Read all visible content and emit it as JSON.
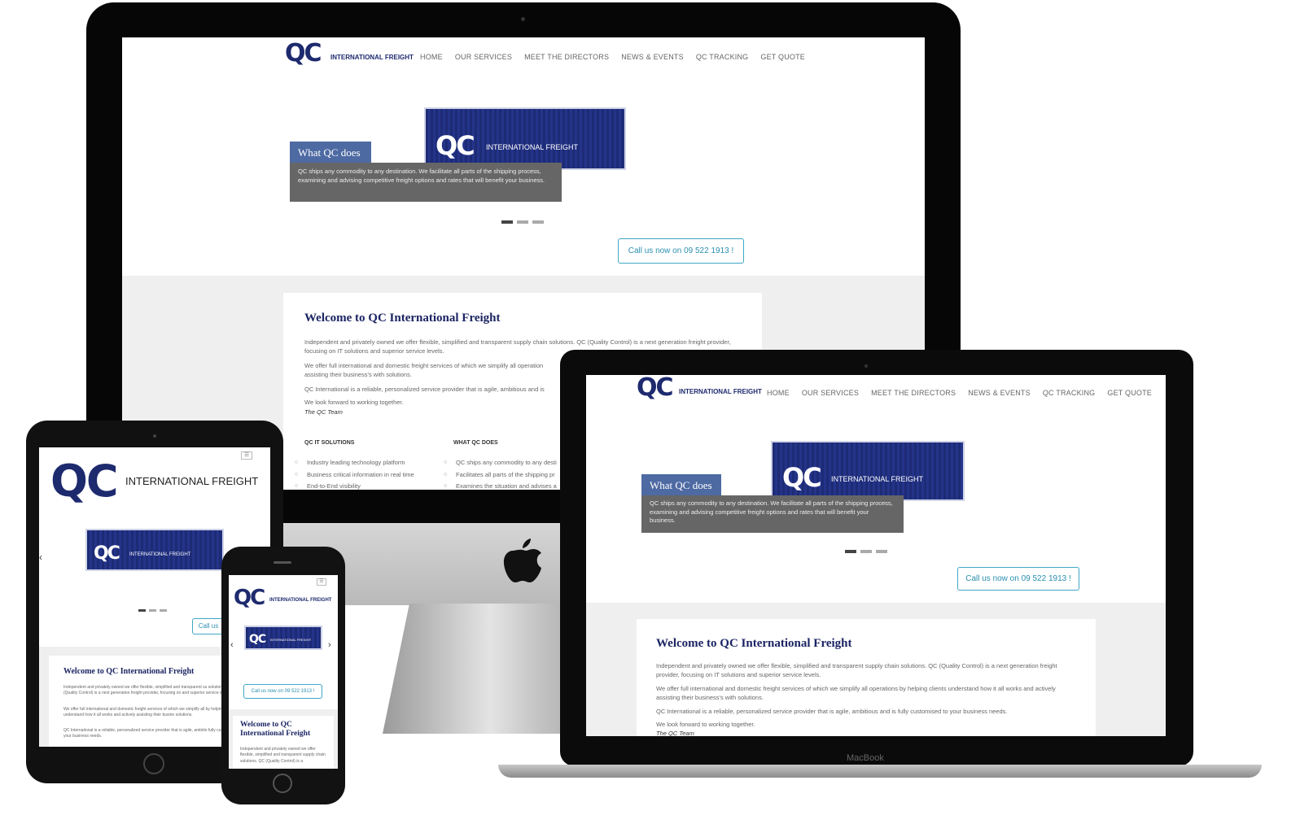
{
  "brand": {
    "logo_letters": "QC",
    "logo_text": "INTERNATIONAL FREIGHT",
    "container_text": "INTERNATIONAL FREIGHT"
  },
  "nav": {
    "items": [
      "HOME",
      "OUR SERVICES",
      "MEET THE DIRECTORS",
      "NEWS & EVENTS",
      "QC TRACKING",
      "GET QUOTE"
    ]
  },
  "slider": {
    "caption_title": "What QC does",
    "caption_body": "QC ships any commodity to any destination. We facilitate all parts of the shipping process, examining and advising competitive freight options and rates that will benefit your business."
  },
  "cta": {
    "label": "Call us now on 09 522 1913 !"
  },
  "welcome": {
    "title": "Welcome to QC International Freight",
    "p1": "Independent and privately owned we offer flexible, simplified and transparent supply chain solutions. QC (Quality Control) is a next generation freight provider, focusing on IT solutions and superior service levels.",
    "p2": "We offer full international and domestic freight services of which we simplify all operations by helping clients understand how it all works and actively assisting their business's with solutions.",
    "p3": "QC International is a reliable, personalized service provider that is agile, ambitious and is fully customised to your business needs.",
    "p4": "We look forward to working together.",
    "sign": "The QC Team"
  },
  "imac_welcome": {
    "p2_visible": "We offer full international and domestic freight services of which we simplify all operation",
    "p2_line2": "assisting their business's with solutions.",
    "p3_visible": "QC International is a reliable, personalized service provider that is agile, ambitious and is"
  },
  "columns": {
    "it_heading": "QC IT SOLUTIONS",
    "it_items": [
      "Industry leading technology platform",
      "Business critical information in real time",
      "End-to-End visibility"
    ],
    "does_heading": "WHAT QC DOES",
    "does_items_visible": [
      "QC ships any commodity to any desti",
      "Facilitates all parts of the shipping pr",
      "Examines the situation and advises a"
    ]
  },
  "tablet": {
    "welcome_title": "Welcome to QC International Freight",
    "p1": "Independent and privately owned we offer flexible, simplified and transparent su solutions. QC (Quality Control) is a next generation freight provider, focusing on and superior service levels.",
    "p2": "We offer full international and domestic freight services of which we simplify all by helping clients understand how it all works and actively assisting their busine solutions.",
    "p3": "QC International is a reliable, personalized service provider that is agile, ambitio fully customised to your business needs.",
    "cta_visible": "Call us"
  },
  "phone": {
    "welcome_title": "Welcome to QC International Freight",
    "p1": "Independent and privately owned we offer flexible, simplified and transparent supply chain solutions. QC (Quality Control) is a",
    "cta": "Call us now on 09 522 1913 !"
  },
  "devices": {
    "laptop_label": "MacBook"
  },
  "colors": {
    "navy": "#1e2a6e",
    "accent": "#3fa7c6",
    "caption_blue": "#4e6aa3"
  }
}
